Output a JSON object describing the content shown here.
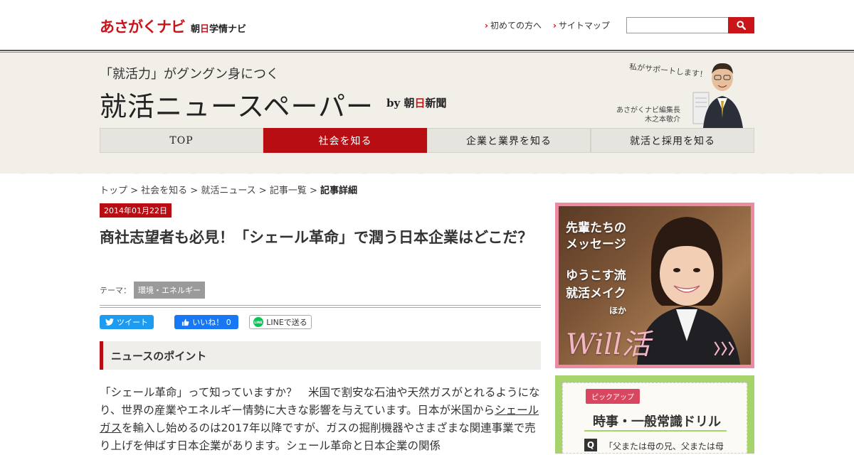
{
  "header": {
    "logo_main": "あさがくナビ",
    "logo_sub_a": "朝",
    "logo_sub_b": "日",
    "logo_sub_c": "学情ナビ",
    "links": [
      "初めての方へ",
      "サイトマップ"
    ],
    "search_placeholder": "",
    "search_icon": "search-icon"
  },
  "banner": {
    "catchcopy": "「就活力」がグングン身につく",
    "title": "就活ニュースペーパー",
    "by": "by",
    "by_a": "朝",
    "by_b": "日",
    "by_c": "新聞",
    "support_text": "私がサポートします！",
    "editor_role": "あさがくナビ編集長",
    "editor_name": "木之本敬介"
  },
  "nav": {
    "items": [
      "TOP",
      "社会を知る",
      "企業と業界を知る",
      "就活と採用を知る"
    ],
    "active_index": 1
  },
  "breadcrumb": {
    "trail": "トップ > 社会を知る > 就活ニュース > 記事一覧 > ",
    "current": "記事詳細"
  },
  "article": {
    "date": "2014年01月22日",
    "title": "商社志望者も必見！「シェール革命」で潤う日本企業はどこだ？",
    "theme_label": "テーマ：",
    "theme_tag": "環境・エネルギー",
    "share": {
      "tweet": "ツイート",
      "like": "いいね！ 0",
      "line": "LINEで送る"
    },
    "point_heading": "ニュースのポイント",
    "body_1": "「シェール革命」って知っていますか？　米国で割安な石油や天然ガスがとれるようになり、世界の産業やエネルギー情勢に大きな影響を与えています。日本が米国から",
    "body_link": "シェールガス",
    "body_2": "を輸入し始めるのは2017年以降ですが、ガスの掘削機器やさまざまな関連事業で売り上げを伸ばす日本企業があります。シェール革命と日本企業の関係"
  },
  "sidebar": {
    "ad1": {
      "line1": "先輩たちの",
      "line2": "メッセージ",
      "line3": "ゆうこす流",
      "line4": "就活メイク",
      "line5": "ほか",
      "will": "Will活",
      "arrows": "〉〉〉"
    },
    "ad2": {
      "pickup": "ピックアップ",
      "title": "時事・一般常識ドリル",
      "q": "Q",
      "question": "「父または母の兄、父または母"
    }
  },
  "colors": {
    "brand_red": "#b80d12",
    "banner_bg": "#f2efe9",
    "ad_pink": "#ec8aa2",
    "ad_green": "#a6d36b"
  }
}
